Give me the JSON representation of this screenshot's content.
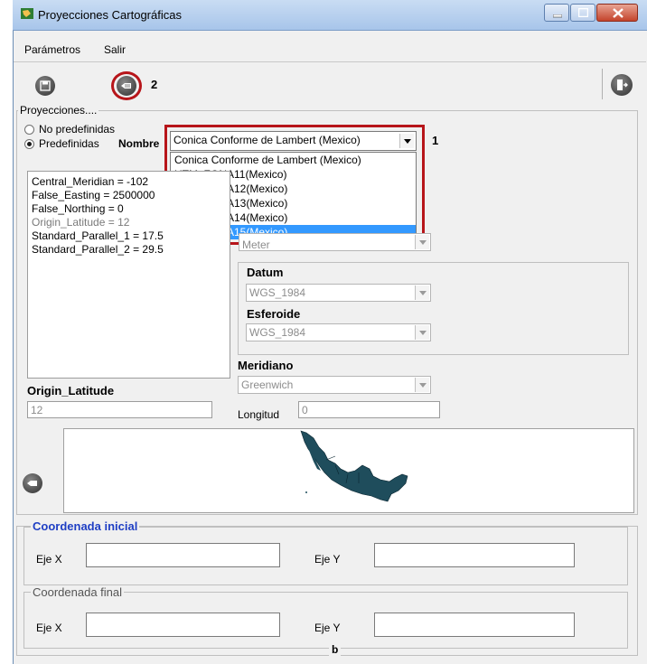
{
  "window": {
    "title": "Proyecciones Cartográficas"
  },
  "menu": {
    "items": [
      "Parámetros",
      "Salir"
    ]
  },
  "toolbar": {
    "callout_2": "2"
  },
  "projections": {
    "group_title": "Proyecciones....",
    "radio_no_predef": "No predefinidas",
    "radio_predef": "Predefinidas",
    "selected_mode": "Predefinidas",
    "name_label": "Nombre",
    "selected_name": "Conica Conforme de Lambert (Mexico)",
    "callout_1": "1",
    "options": [
      "Conica Conforme de Lambert (Mexico)",
      "UTM_ZONA11(Mexico)",
      "UTM_ZONA12(Mexico)",
      "UTM_ZONA13(Mexico)",
      "UTM_ZONA14(Mexico)",
      "UTM_ZONA15(Mexico)"
    ],
    "highlighted_option": "UTM_ZONA15(Mexico)"
  },
  "parameters": {
    "list": [
      "Central_Meridian = -102",
      "False_Easting = 2500000",
      "False_Northing = 0",
      "Origin_Latitude = 12",
      "Standard_Parallel_1 = 17.5",
      "Standard_Parallel_2 = 29.5"
    ],
    "selected_param_label": "Origin_Latitude",
    "selected_param_value": "12"
  },
  "units": {
    "value": "Meter"
  },
  "datum": {
    "label": "Datum",
    "value": "WGS_1984",
    "spheroid_label": "Esferoide",
    "spheroid_value": "WGS_1984"
  },
  "meridian": {
    "label": "Meridiano",
    "value": "Greenwich",
    "longitude_label": "Longitud",
    "longitude_value": "0"
  },
  "coords": {
    "initial_title": "Coordenada inicial",
    "final_title": "Coordenada final",
    "x_label": "Eje X",
    "y_label": "Eje Y",
    "initial_x": "",
    "initial_y": "",
    "final_x": "",
    "final_y": "",
    "figure_label": "b"
  },
  "colors": {
    "accent_red": "#b7151a",
    "selection_blue": "#3399ff",
    "map_fill": "#1f4d5c"
  }
}
